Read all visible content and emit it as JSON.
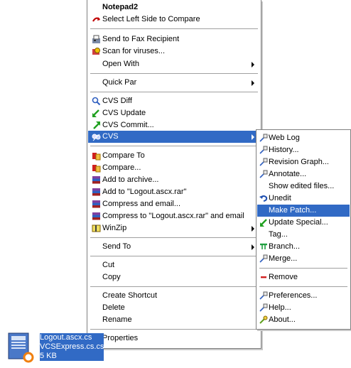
{
  "main_menu": {
    "items": [
      {
        "id": "notepad2",
        "label": "Notepad2",
        "bold": true,
        "icon": "none"
      },
      {
        "id": "select-left",
        "label": "Select Left Side to Compare",
        "icon": "compare-arrow-icon"
      },
      {
        "id": "fax",
        "label": "Send to Fax Recipient",
        "icon": "fax-icon"
      },
      {
        "id": "scan",
        "label": "Scan for viruses...",
        "icon": "scan-icon"
      },
      {
        "id": "open-with",
        "label": "Open With",
        "icon": "none",
        "submenu": true
      },
      {
        "id": "quick-par",
        "label": "Quick Par",
        "icon": "none",
        "submenu": true
      },
      {
        "id": "cvs-diff",
        "label": "CVS Diff",
        "icon": "cvs-diff-icon"
      },
      {
        "id": "cvs-update",
        "label": "CVS Update",
        "icon": "cvs-update-icon"
      },
      {
        "id": "cvs-commit",
        "label": "CVS Commit...",
        "icon": "cvs-commit-icon"
      },
      {
        "id": "cvs",
        "label": "CVS",
        "icon": "cvs-icon",
        "submenu": true,
        "selected": true
      },
      {
        "id": "compare-to",
        "label": "Compare To",
        "icon": "compare-icon"
      },
      {
        "id": "compare",
        "label": "Compare...",
        "icon": "compare-icon"
      },
      {
        "id": "add-archive",
        "label": "Add to archive...",
        "icon": "winrar-icon"
      },
      {
        "id": "add-rar",
        "label": "Add to \"Logout.ascx.rar\"",
        "icon": "winrar-icon"
      },
      {
        "id": "compress-email",
        "label": "Compress and email...",
        "icon": "winrar-icon"
      },
      {
        "id": "compress-rar-email",
        "label": "Compress to \"Logout.ascx.rar\" and email",
        "icon": "winrar-icon"
      },
      {
        "id": "winzip",
        "label": "WinZip",
        "icon": "winzip-icon",
        "submenu": true
      },
      {
        "id": "send-to",
        "label": "Send To",
        "icon": "none",
        "submenu": true
      },
      {
        "id": "cut",
        "label": "Cut",
        "icon": "none"
      },
      {
        "id": "copy",
        "label": "Copy",
        "icon": "none"
      },
      {
        "id": "create-shortcut",
        "label": "Create Shortcut",
        "icon": "none"
      },
      {
        "id": "delete",
        "label": "Delete",
        "icon": "none"
      },
      {
        "id": "rename",
        "label": "Rename",
        "icon": "none"
      },
      {
        "id": "properties",
        "label": "Properties",
        "icon": "none"
      }
    ]
  },
  "cvs_menu": {
    "items": [
      {
        "id": "web-log",
        "label": "Web Log",
        "icon": "log-icon"
      },
      {
        "id": "history",
        "label": "History...",
        "icon": "log-icon"
      },
      {
        "id": "revision-graph",
        "label": "Revision Graph...",
        "icon": "log-icon"
      },
      {
        "id": "annotate",
        "label": "Annotate...",
        "icon": "log-icon"
      },
      {
        "id": "show-edited",
        "label": "Show edited files...",
        "icon": "none"
      },
      {
        "id": "unedit",
        "label": "Unedit",
        "icon": "undo-icon"
      },
      {
        "id": "make-patch",
        "label": "Make Patch...",
        "icon": "none",
        "selected": true
      },
      {
        "id": "update-special",
        "label": "Update Special...",
        "icon": "cvs-update-icon"
      },
      {
        "id": "tag",
        "label": "Tag...",
        "icon": "none"
      },
      {
        "id": "branch",
        "label": "Branch...",
        "icon": "branch-icon"
      },
      {
        "id": "merge",
        "label": "Merge...",
        "icon": "log-icon"
      },
      {
        "id": "remove",
        "label": "Remove",
        "icon": "remove-icon"
      },
      {
        "id": "preferences",
        "label": "Preferences...",
        "icon": "log-icon"
      },
      {
        "id": "help",
        "label": "Help...",
        "icon": "log-icon"
      },
      {
        "id": "about",
        "label": "About...",
        "icon": "about-icon"
      }
    ]
  },
  "file": {
    "name_line1": "Logout.ascx.cs",
    "name_line2": "VCSExpress.cs.cs",
    "size": "5 KB"
  },
  "colors": {
    "selection": "#316ac5",
    "menu_border": "#808080"
  }
}
